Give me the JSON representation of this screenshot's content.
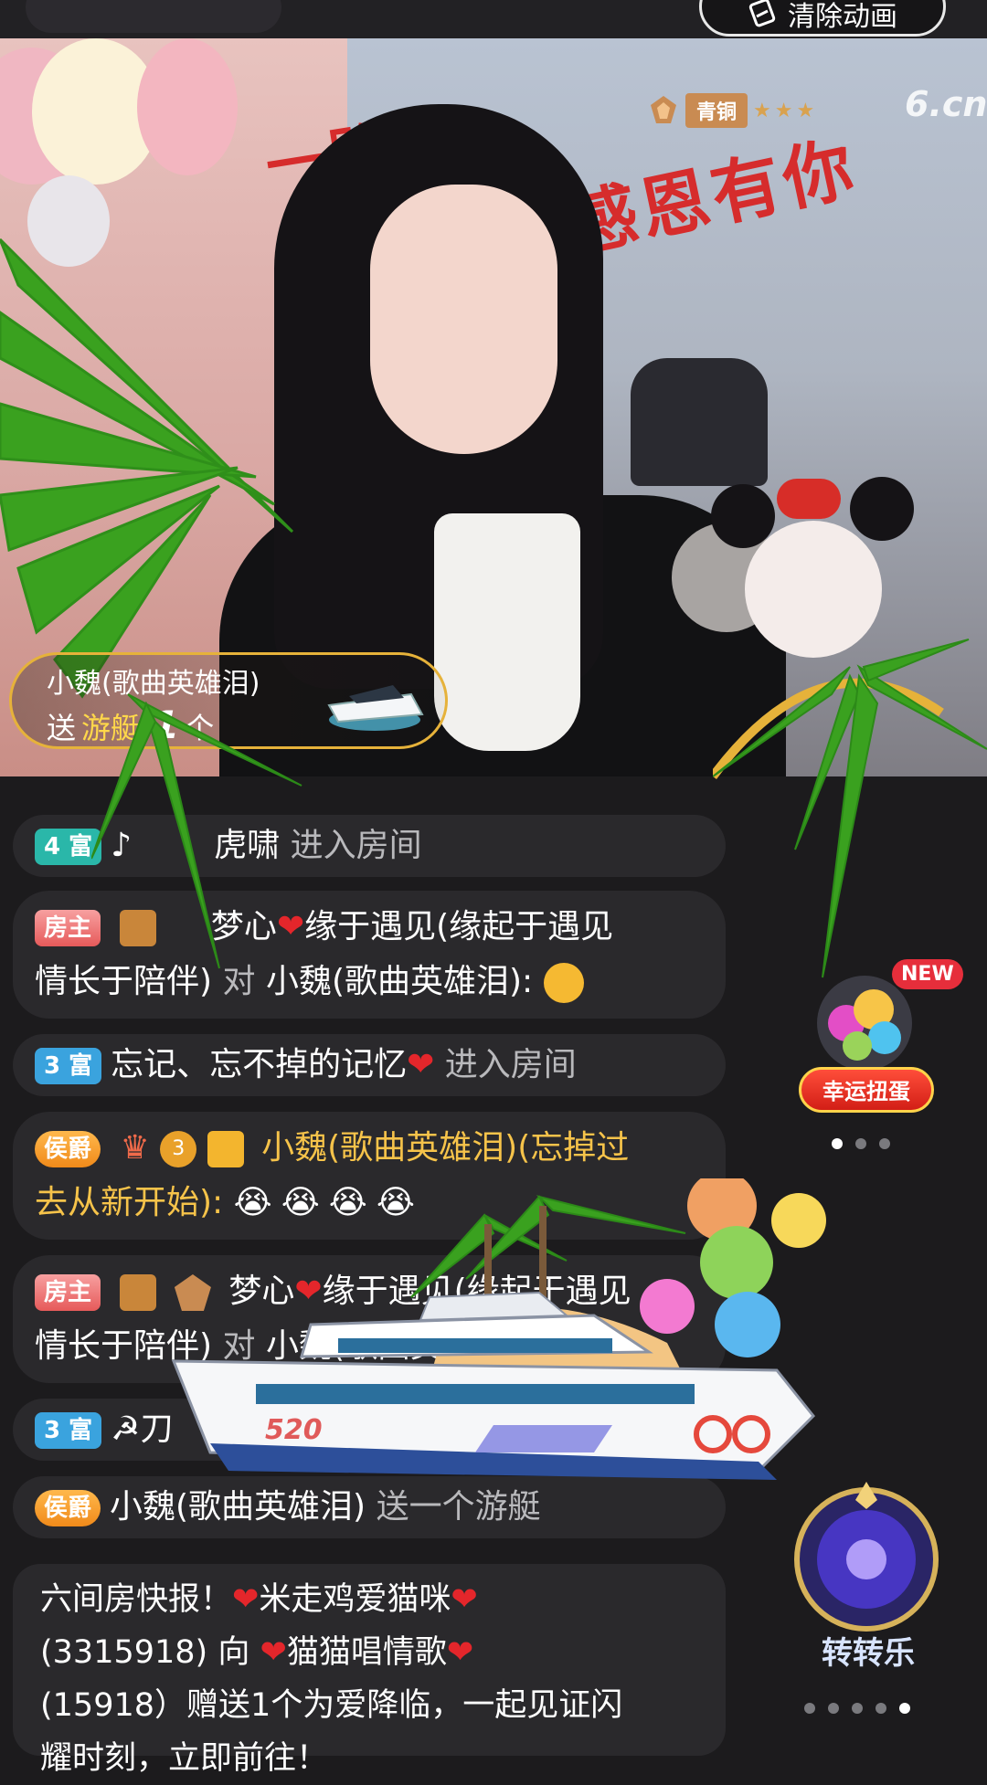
{
  "header": {
    "clear_button_label": "清除动画"
  },
  "stream": {
    "anchor_level_name": "青铜",
    "anchor_level_stars": "★★★",
    "watermark": "6.cn",
    "backdrop_banner_left": "一路",
    "backdrop_banner_right": "感恩有你"
  },
  "gift_notice": {
    "sender": "小魏(歌曲英雄泪)",
    "verb": "送",
    "gift_name": "游艇",
    "count": "1",
    "unit": "个"
  },
  "chat": {
    "messages": [
      {
        "badge": "4 富",
        "user": "虎啸",
        "action": "进入房间",
        "prefix": "♪"
      },
      {
        "badge": "房主",
        "line1_user": "梦心",
        "line1_rest": "缘于遇见(缘起于遇见",
        "line2": "情长于陪伴)",
        "to": "对",
        "target": "小魏(歌曲英雄泪):"
      },
      {
        "badge": "3 富",
        "user": "忘记、忘不掉的记忆",
        "action": "进入房间"
      },
      {
        "badge": "侯爵",
        "vip_level": "3",
        "user_line1": "小魏(歌曲英雄泪)(忘掉过",
        "user_line2": "去从新开始):"
      },
      {
        "badge": "房主",
        "line1_user": "梦心",
        "line1_rest": "缘于遇见(缘起于遇见",
        "line2": "情长于陪伴)",
        "to": "对",
        "target": "小魏(歌曲英雄泪):"
      },
      {
        "badge": "3 富",
        "prefix": "☭",
        "user": "刀"
      },
      {
        "badge": "侯爵",
        "user": "小魏(歌曲英雄泪)",
        "rest": "送一个游艇"
      },
      {
        "system_line1": "六间房快报！",
        "system_user1": "米走鸡爱猫咪",
        "system_line2_id": "(3315918)",
        "system_line2_dir": "向",
        "system_user2": "猫猫唱情歌",
        "system_line3": "(15918）赠送1个为爱降临，一起见证闪",
        "system_line4": "耀时刻，立即前往！"
      }
    ]
  },
  "side": {
    "gacha_new": "NEW",
    "gacha_label": "幸运扭蛋",
    "spin_label": "转转乐"
  },
  "gift_animation": {
    "yacht_number": "520"
  }
}
